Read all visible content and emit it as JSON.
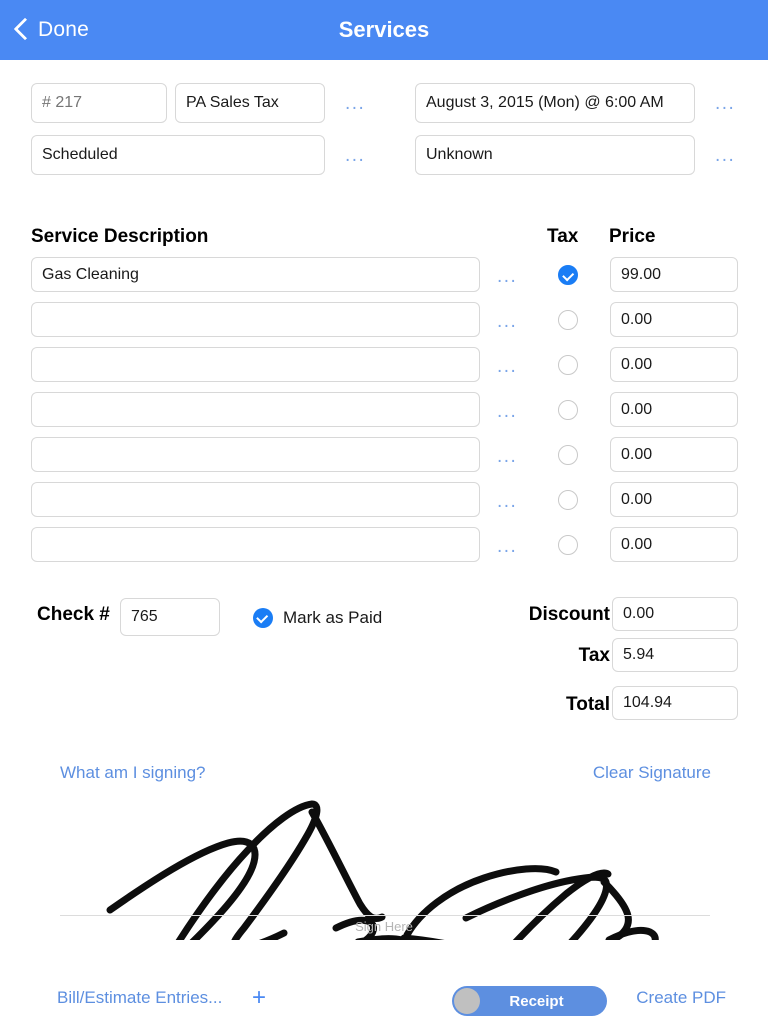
{
  "navbar": {
    "back_label": "Done",
    "title": "Services",
    "bg_color": "#4a89f3"
  },
  "meta": {
    "invoice_number_placeholder": "# 217",
    "invoice_number_value": "",
    "tax_profile": "PA Sales Tax",
    "date": "August 3, 2015 (Mon) @ 6:00 AM",
    "status": "Scheduled",
    "technician": "Unknown",
    "ellipsis": "..."
  },
  "services": {
    "header": {
      "description": "Service Description",
      "tax": "Tax",
      "price": "Price"
    },
    "ellipsis": "...",
    "rows": [
      {
        "description": "Gas Cleaning",
        "taxable": true,
        "price": "99.00"
      },
      {
        "description": "",
        "taxable": false,
        "price": "0.00"
      },
      {
        "description": "",
        "taxable": false,
        "price": "0.00"
      },
      {
        "description": "",
        "taxable": false,
        "price": "0.00"
      },
      {
        "description": "",
        "taxable": false,
        "price": "0.00"
      },
      {
        "description": "",
        "taxable": false,
        "price": "0.00"
      },
      {
        "description": "",
        "taxable": false,
        "price": "0.00"
      }
    ]
  },
  "payment": {
    "check_label": "Check #",
    "check_value": "765",
    "mark_as_paid_label": "Mark as Paid",
    "mark_as_paid_checked": true
  },
  "totals": {
    "discount_label": "Discount",
    "discount_value": "0.00",
    "tax_label": "Tax",
    "tax_value": "5.94",
    "total_label": "Total",
    "total_value": "104.94"
  },
  "signature": {
    "what_am_i_signing": "What am I signing?",
    "clear_signature": "Clear Signature",
    "sign_here": "Sign Here",
    "signed": true
  },
  "footer": {
    "bill_entries": "Bill/Estimate Entries...",
    "add_icon": "+",
    "toggle_label": "Receipt",
    "toggle_on": true,
    "create_pdf": "Create PDF"
  },
  "colors": {
    "accent_blue": "#4a89f3",
    "link_blue": "#5d8fe0",
    "check_blue": "#1a7df5",
    "field_border": "#d8d8d8"
  }
}
